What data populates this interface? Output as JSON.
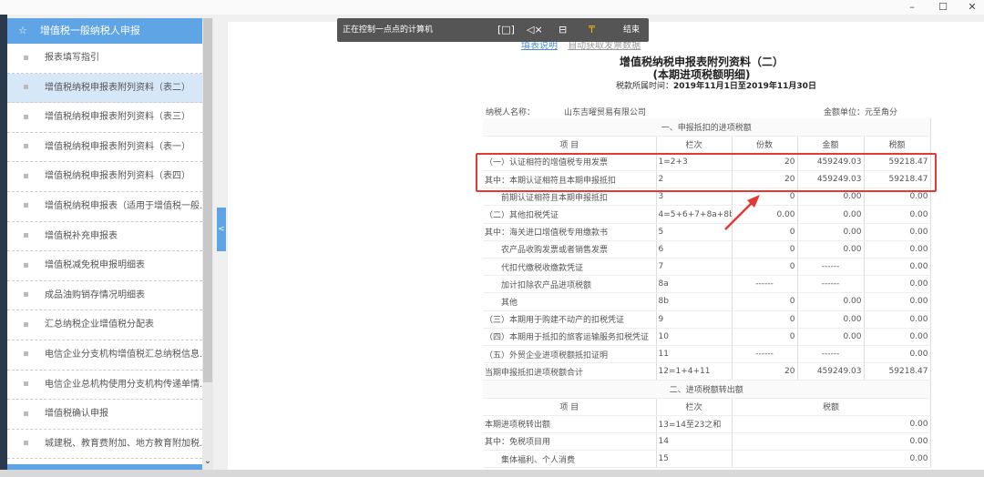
{
  "window": {
    "minimize": "–",
    "maximize": "☐",
    "close": "✕"
  },
  "remote_bar": {
    "label": "正在控制一点点的计算机",
    "end": "结束"
  },
  "sidebar": {
    "header": "增值税一般纳税人申报",
    "items": [
      {
        "label": "报表填写指引"
      },
      {
        "label": "增值税纳税申报表附列资料（表二）",
        "active": true
      },
      {
        "label": "增值税纳税申报表附列资料（表三）"
      },
      {
        "label": "增值税纳税申报表附列资料（表一）"
      },
      {
        "label": "增值税纳税申报表附列资料（表四）"
      },
      {
        "label": "增值税纳税申报表（适用于增值税一般..."
      },
      {
        "label": "增值税补充申报表"
      },
      {
        "label": "增值税减免税申报明细表"
      },
      {
        "label": "成品油购销存情况明细表"
      },
      {
        "label": "汇总纳税企业增值税分配表"
      },
      {
        "label": "电信企业分支机构增值税汇总纳税信息..."
      },
      {
        "label": "电信企业总机构使用分支机构传递单情..."
      },
      {
        "label": "增值税确认申报"
      },
      {
        "label": "城建税、教育费附加、地方教育附加税..."
      }
    ],
    "collapse": "<",
    "scroll_down": "⌄"
  },
  "form": {
    "links": [
      "填表说明",
      "自动获取发票数据"
    ],
    "title": "增值税纳税申报表附列资料（二）",
    "subtitle": "(本期进项税额明细)",
    "period_label": "税款所属时间：",
    "period": "2019年11月1日至2019年11月30日",
    "taxpayer_label": "纳税人名称：",
    "taxpayer": "山东吉曜贸易有限公司",
    "unit": "金额单位：元至角分",
    "section1": "一、申报抵扣的进项税额",
    "headers1": [
      "项  目",
      "栏次",
      "份数",
      "金额",
      "税额"
    ],
    "rows1": [
      [
        "（一）认证相符的增值税专用发票",
        "1=2+3",
        "20",
        "459249.03",
        "59218.47"
      ],
      [
        "其中：本期认证相符且本期申报抵扣",
        "2",
        "20",
        "459249.03",
        "59218.47"
      ],
      [
        "　　前期认证相符且本期申报抵扣",
        "3",
        "0",
        "0.00",
        "0.00"
      ],
      [
        "（二）其他扣税凭证",
        "4=5+6+7+8a+8b",
        "0.00",
        "0.00",
        "0.00"
      ],
      [
        "其中：海关进口增值税专用缴款书",
        "5",
        "0",
        "0.00",
        "0.00"
      ],
      [
        "　　农产品收购发票或者销售发票",
        "6",
        "0",
        "0.00",
        "0.00"
      ],
      [
        "　　代扣代缴税收缴款凭证",
        "7",
        "0",
        "------",
        "0.00"
      ],
      [
        "　　加计扣除农产品进项税额",
        "8a",
        "------",
        "------",
        "0.00"
      ],
      [
        "　　其他",
        "8b",
        "0",
        "0.00",
        "0.00"
      ],
      [
        "（三）本期用于购建不动产的扣税凭证",
        "9",
        "0",
        "0.00",
        "0.00"
      ],
      [
        "（四）本期用于抵扣的旅客运输服务扣税凭证",
        "10",
        "0",
        "0.00",
        "0.00"
      ],
      [
        "（五）外贸企业进项税额抵扣证明",
        "11",
        "------",
        "------",
        "0.00"
      ],
      [
        "当期申报抵扣进项税额合计",
        "12=1+4+11",
        "20",
        "459249.03",
        "59218.47"
      ]
    ],
    "section2": "二、进项税额转出额",
    "headers2": [
      "项  目",
      "栏次",
      "税额"
    ],
    "rows2": [
      [
        "本期进项税转出额",
        "13=14至23之和",
        "0.00"
      ],
      [
        "其中：免税项目用",
        "14",
        "0.00"
      ],
      [
        "　　集体福利、个人消费",
        "15",
        "0.00"
      ]
    ]
  },
  "colors": {
    "accent": "#5fa5e6",
    "highlight": "#e53935"
  }
}
